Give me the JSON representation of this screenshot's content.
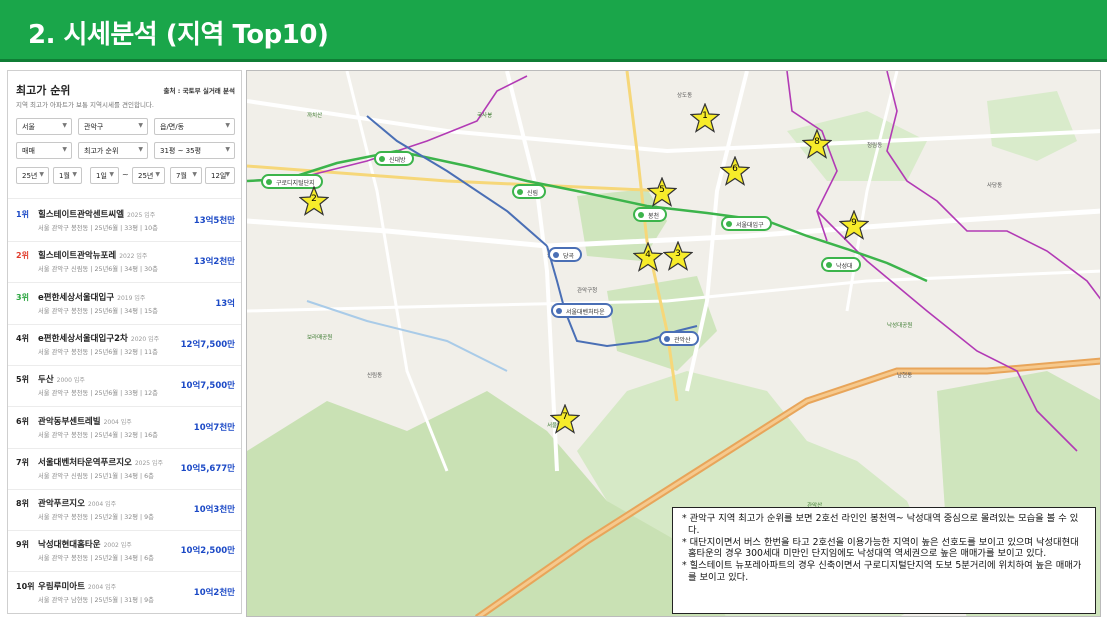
{
  "header": {
    "title": "2. 시세분석 (지역 Top10)"
  },
  "panel": {
    "title": "최고가 순위",
    "source": "출처 : 국토부 실거래 분석",
    "desc": "지역 최고가 아파트가 보통 지역시세를 견인합니다.",
    "filters": {
      "sido": "서울",
      "gu": "관악구",
      "dong": "읍/면/동",
      "deal": "매매",
      "sort": "최고가 순위",
      "size": "31평 ~ 35평",
      "y1": "25년",
      "m1": "1월",
      "d1": "1일",
      "y2": "25년",
      "m2": "7월",
      "d2": "12일",
      "tilde": "~"
    },
    "items": [
      {
        "rank": "1위",
        "name": "힐스테이트관악센트씨엘",
        "year": "2025 입주",
        "detail": "서울 관악구 봉천동  |  25년6월  |  33평  |  10층",
        "price": "13억5천만",
        "color": "#1b49c6"
      },
      {
        "rank": "2위",
        "name": "힐스테이트관악뉴포레",
        "year": "2022 입주",
        "detail": "서울 관악구 신림동  |  25년6월  |  34평  |  30층",
        "price": "13억2천만",
        "color": "#e03b2b"
      },
      {
        "rank": "3위",
        "name": "e편한세상서울대입구",
        "year": "2019 입주",
        "detail": "서울 관악구 봉천동  |  25년6월  |  34평  |  15층",
        "price": "13억",
        "color": "#2aa53f"
      },
      {
        "rank": "4위",
        "name": "e편한세상서울대입구2차",
        "year": "2020 입주",
        "detail": "서울 관악구 봉천동  |  25년6월  |  32평  |  11층",
        "price": "12억7,500만",
        "color": "#222"
      },
      {
        "rank": "5위",
        "name": "두산",
        "year": "2000 입주",
        "detail": "서울 관악구 봉천동  |  25년6월  |  33평  |  12층",
        "price": "10억7,500만",
        "color": "#222"
      },
      {
        "rank": "6위",
        "name": "관악동부센트레빌",
        "year": "2004 입주",
        "detail": "서울 관악구 봉천동  |  25년4월  |  32평  |  16층",
        "price": "10억7천만",
        "color": "#222"
      },
      {
        "rank": "7위",
        "name": "서울대벤처타운역푸르지오",
        "year": "2025 입주",
        "detail": "서울 관악구 신림동  |  25년1월  |  34평  |  6층",
        "price": "10억5,677만",
        "color": "#222"
      },
      {
        "rank": "8위",
        "name": "관악푸르지오",
        "year": "2004 입주",
        "detail": "서울 관악구 봉천동  |  25년2월  |  32평  |  9층",
        "price": "10억3천만",
        "color": "#222"
      },
      {
        "rank": "9위",
        "name": "낙성대현대홈타운",
        "year": "2002 입주",
        "detail": "서울 관악구 봉천동  |  25년2월  |  34평  |  6층",
        "price": "10억2,500만",
        "color": "#222"
      },
      {
        "rank": "10위",
        "name": "우림루미아트",
        "year": "2004 입주",
        "detail": "서울 관악구 남현동  |  25년5월  |  31평  |  9층",
        "price": "10억2천만",
        "color": "#222"
      }
    ]
  },
  "map": {
    "stations": [
      {
        "id": "sindaebang",
        "name": "신대방"
      },
      {
        "id": "gurodigital",
        "name": "구로디지털단지"
      },
      {
        "id": "sillim",
        "name": "신림"
      },
      {
        "id": "bongcheon",
        "name": "봉천"
      },
      {
        "id": "seoulnat",
        "name": "서울대입구"
      },
      {
        "id": "nakseongdae",
        "name": "낙성대"
      },
      {
        "id": "dangok",
        "name": "당곡"
      },
      {
        "id": "seoulventure",
        "name": "서울대벤처타운"
      },
      {
        "id": "gwanak",
        "name": "관악산"
      }
    ],
    "stars": [
      "1",
      "2",
      "3",
      "4",
      "5",
      "6",
      "7",
      "8",
      "9"
    ],
    "place_labels": [
      "보라매공원",
      "신림동",
      "봉천동",
      "남현동",
      "관악산",
      "서울대학교",
      "낙성대공원",
      "국사봉",
      "까치산",
      "사당동",
      "상도동",
      "청림동",
      "관악구청"
    ]
  },
  "note": {
    "lines": [
      "* 관악구 지역 최고가 순위를 보면 2호선 라인인 봉천역~ 낙성대역 중심으로 몰려있는 모습을 볼 수 있다.",
      "* 대단지이면서 버스 한번을 타고 2호선을 이용가능한 지역이 높은 선호도를 보이고 있으며 낙성대현대홈타운의 경우 300세대 미만인 단지임에도 낙성대역 역세권으로 높은 매매가를 보이고 있다.",
      "* 힐스테이트 뉴포레아파트의 경우 신축이면서 구로디지털단지역 도보 5분거리에 위치하여 높은 매매가를 보이고 있다."
    ]
  },
  "colors": {
    "header": "#1aa64a",
    "line2": "#3cb44b",
    "sillimline": "#4a6fb5",
    "purple": "#b23ab5",
    "price": "#1b49c6",
    "expressway": "#e8a55a",
    "forest": "#b9d9a3"
  }
}
